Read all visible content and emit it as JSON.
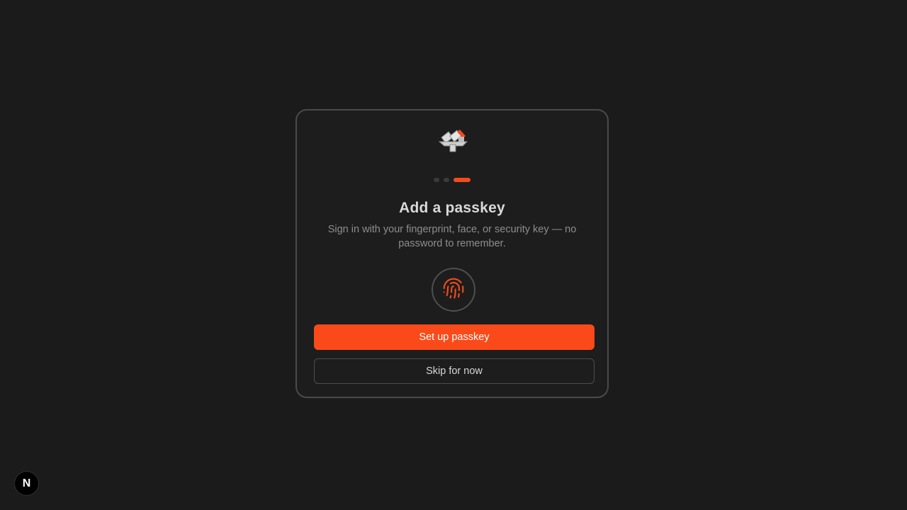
{
  "colors": {
    "accent": "#fa4a1a",
    "background": "#1b1b1b",
    "card_border": "#4a4a4a"
  },
  "onboarding": {
    "logo_icon": "app-logo-icon",
    "step_count": 3,
    "current_step": 3,
    "title": "Add a passkey",
    "subtitle": "Sign in with your fingerprint, face, or security key — no password to remember.",
    "illustration_icon": "fingerprint-icon",
    "primary_button_label": "Set up passkey",
    "secondary_button_label": "Skip for now"
  },
  "dev_badge": {
    "label": "N",
    "icon": "nextjs-logo-icon"
  }
}
